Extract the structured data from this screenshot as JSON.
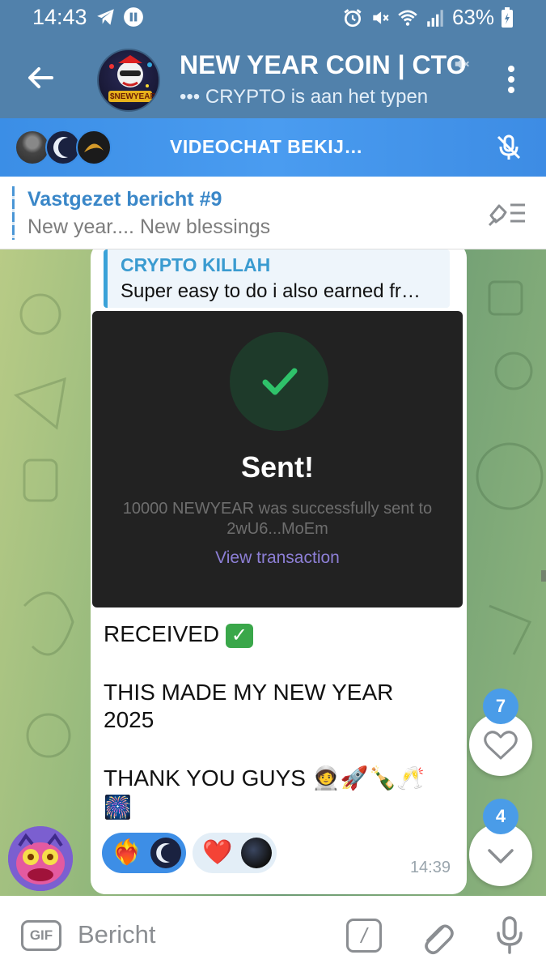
{
  "status_bar": {
    "time": "14:43",
    "battery": "63%",
    "icons": [
      "telegram-icon",
      "pause-icon",
      "alarm-icon",
      "mute-vibrate-icon",
      "wifi-icon",
      "signal-icon",
      "battery-icon"
    ]
  },
  "header": {
    "title": "NEW YEAR COIN | CTO",
    "subtitle": "CRYPTO is aan het typen",
    "typing_dots": "•••",
    "avatar_caption": "$NEWYEAR"
  },
  "videochat": {
    "label": "VIDEOCHAT BEKIJ…"
  },
  "pinned": {
    "title": "Vastgezet bericht #9",
    "text": "New year.... New blessings"
  },
  "message": {
    "reply_name": "CRYPTO KILLAH",
    "reply_text": "Super easy to do i also earned fr…",
    "screenshot": {
      "title": "Sent!",
      "line1": "10000 NEWYEAR was successfully sent to",
      "line2": "2wU6...MoEm",
      "link": "View transaction"
    },
    "line_received": "RECEIVED",
    "line_made_1": "THIS MADE MY NEW YEAR",
    "line_made_2": "2025",
    "line_thanks": "THANK YOU GUYS 🧑‍🚀🚀🍾🥂",
    "line_firework": "🎆",
    "reactions": [
      {
        "emoji": "❤️‍🔥"
      },
      {
        "emoji": "❤️"
      }
    ],
    "time": "14:39"
  },
  "fab": {
    "reactions_badge": "7",
    "scroll_badge": "4"
  },
  "input": {
    "gif_label": "GIF",
    "placeholder": "Bericht",
    "command_label": "/"
  },
  "colors": {
    "header_bg": "#5181ab",
    "videochat_bg": "#3b8ee6",
    "accent": "#3a87c8",
    "badge": "#4a9ce8"
  }
}
